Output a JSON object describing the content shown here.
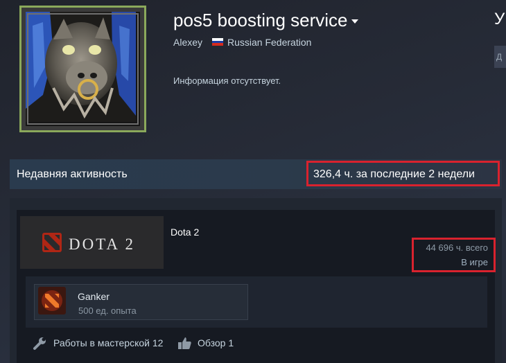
{
  "profile": {
    "persona_name": "pos5 boosting service",
    "real_name": "Alexey",
    "country": "Russian Federation",
    "summary": "Информация отсутствует.",
    "level_partial": "У",
    "level_button_partial": "Д"
  },
  "recent_activity": {
    "title": "Недавняя активность",
    "hours_text": "326,4 ч. за последние 2 недели"
  },
  "game": {
    "name": "Dota 2",
    "logo_text": "DOTA 2",
    "total_hours": "44 696 ч. всего",
    "status": "В игре",
    "achievement": {
      "title": "Ganker",
      "xp": "500 ед. опыта"
    },
    "workshop": "Работы в мастерской 12",
    "reviews": "Обзор 1"
  },
  "colors": {
    "highlight": "#d9222e",
    "avatar_border": "#8ba95b",
    "flag": [
      "#ffffff",
      "#1c3fa8",
      "#d52b1e"
    ]
  },
  "icons": [
    "caret-down-icon",
    "flag-ru-icon",
    "dota-logo-icon",
    "achievement-icon",
    "wrench-icon",
    "thumbs-up-icon"
  ]
}
